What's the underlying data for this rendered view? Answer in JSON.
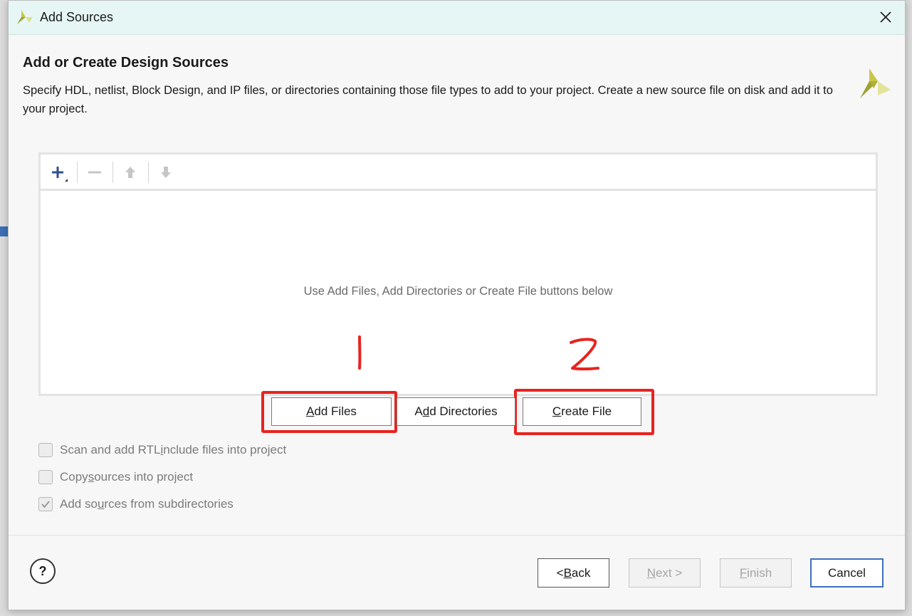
{
  "window": {
    "title": "Add Sources"
  },
  "header": {
    "heading": "Add or Create Design Sources",
    "description": "Specify HDL, netlist, Block Design, and IP files, or directories containing those file types to add to your project. Create a new source file on disk and add it to your project."
  },
  "file_list": {
    "empty_message": "Use Add Files, Add Directories or Create File buttons below"
  },
  "annotations": {
    "first": "1",
    "second": "2"
  },
  "buttons": {
    "add_files": {
      "pre": "",
      "key": "A",
      "post": "dd Files"
    },
    "add_directories": {
      "pre": "A",
      "key": "d",
      "post": "d Directories"
    },
    "create_file": {
      "pre": "",
      "key": "C",
      "post": "reate File"
    }
  },
  "options": [
    {
      "pre": "Scan and add RTL ",
      "key": "i",
      "post": "nclude files into project",
      "checked": false
    },
    {
      "pre": "Copy ",
      "key": "s",
      "post": "ources into project",
      "checked": false
    },
    {
      "pre": "Add so",
      "key": "u",
      "post": "rces from subdirectories",
      "checked": true
    }
  ],
  "footer": {
    "help": "?",
    "back": {
      "pre": "< ",
      "key": "B",
      "post": "ack"
    },
    "next": {
      "pre": "",
      "key": "N",
      "post": "ext >"
    },
    "finish": {
      "pre": "",
      "key": "F",
      "post": "inish"
    },
    "cancel": "Cancel"
  },
  "colors": {
    "annotation": "#e8231f",
    "titlebar": "#e6f6f4",
    "primary_border": "#3d6fc0"
  }
}
